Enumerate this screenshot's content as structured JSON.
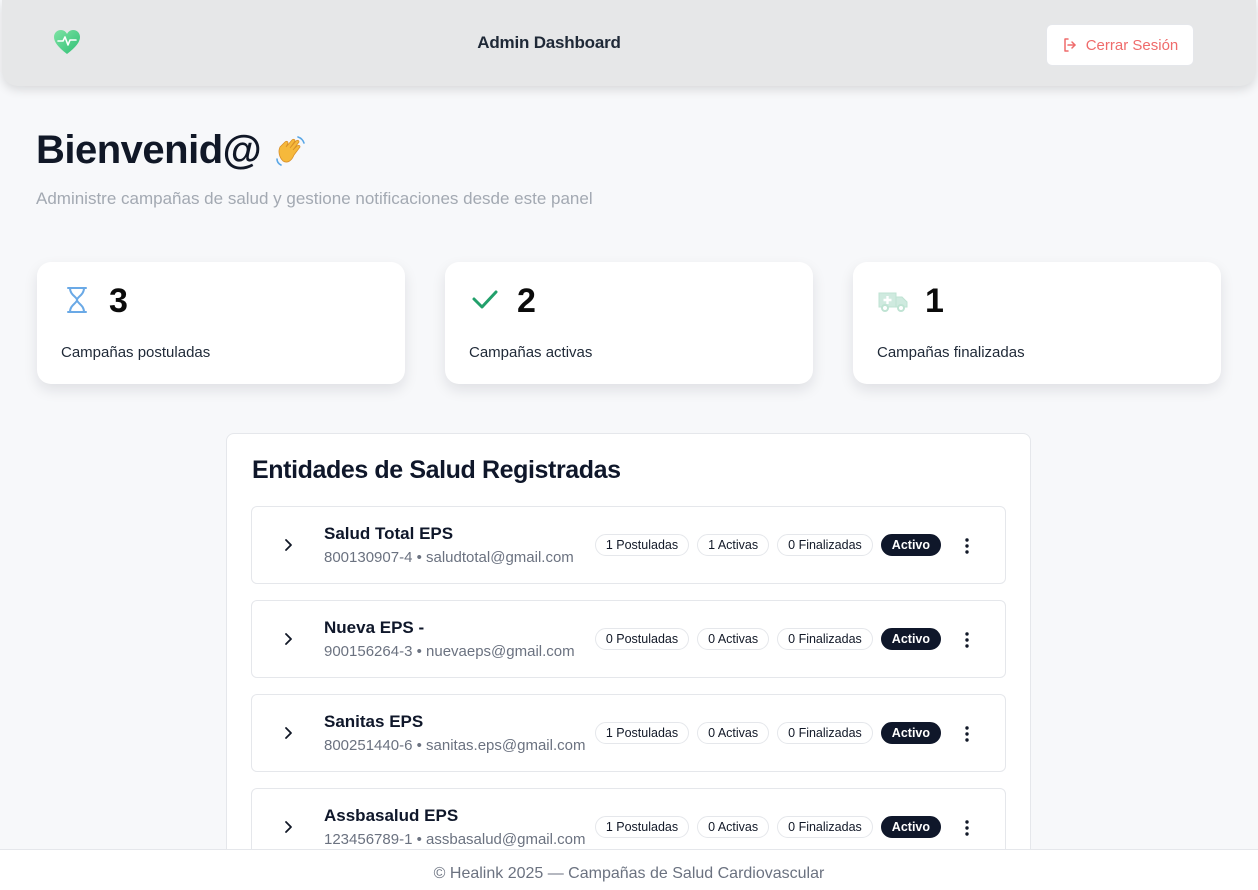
{
  "header": {
    "title": "Admin Dashboard",
    "logout_label": "Cerrar Sesión",
    "logo_icon": "heart-pulse-icon",
    "accent_color": "#ef6b6b"
  },
  "welcome": {
    "title": "Bienvenid@",
    "emoji_icon": "waving-hand-icon",
    "subtitle": "Administre campañas de salud y gestione notificaciones desde este panel"
  },
  "stats": [
    {
      "icon": "hourglass-icon",
      "count": "3",
      "label": "Campañas postuladas",
      "color": "#6aa9e6"
    },
    {
      "icon": "check-icon",
      "count": "2",
      "label": "Campañas activas",
      "color": "#22a06b"
    },
    {
      "icon": "ambulance-icon",
      "count": "1",
      "label": "Campañas finalizadas",
      "color": "#bfe3d3"
    }
  ],
  "entities_panel": {
    "title": "Entidades de Salud Registradas",
    "items": [
      {
        "name": "Salud Total EPS",
        "meta": "800130907-4 • saludtotal@gmail.com",
        "postuladas": "1 Postuladas",
        "activas": "1 Activas",
        "finalizadas": "0 Finalizadas",
        "status": "Activo"
      },
      {
        "name": "Nueva EPS -",
        "meta": "900156264-3 • nuevaeps@gmail.com",
        "postuladas": "0 Postuladas",
        "activas": "0 Activas",
        "finalizadas": "0 Finalizadas",
        "status": "Activo"
      },
      {
        "name": "Sanitas EPS",
        "meta": "800251440-6 • sanitas.eps@gmail.com",
        "postuladas": "1 Postuladas",
        "activas": "0 Activas",
        "finalizadas": "0 Finalizadas",
        "status": "Activo"
      },
      {
        "name": "Assbasalud EPS",
        "meta": "123456789-1 • assbasalud@gmail.com",
        "postuladas": "1 Postuladas",
        "activas": "0 Activas",
        "finalizadas": "0 Finalizadas",
        "status": "Activo"
      }
    ]
  },
  "footer": {
    "text": "© Healink 2025 — Campañas de Salud Cardiovascular"
  }
}
